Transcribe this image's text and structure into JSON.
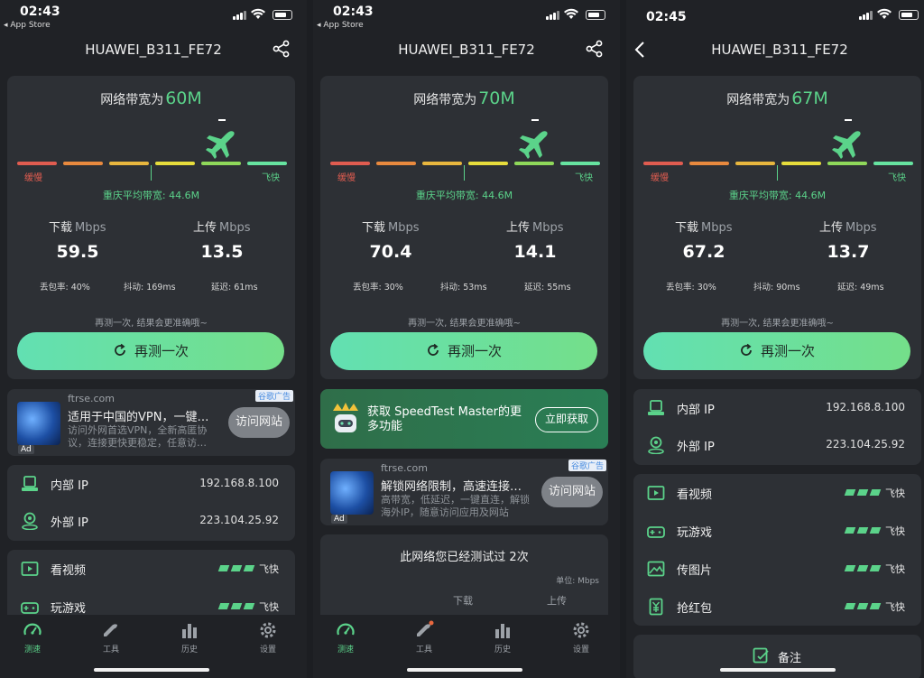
{
  "screens": [
    {
      "status": {
        "time": "02:43",
        "back": "◂ App Store"
      },
      "title": "HUAWEI_B311_FE72",
      "bandwidth": {
        "label": "网络带宽为",
        "value": "60M"
      },
      "scale": {
        "slow": "缓慢",
        "fast": "飞快",
        "avg": "重庆平均带宽: 44.6M"
      },
      "download": {
        "label": "下载",
        "unit": "Mbps",
        "value": "59.5"
      },
      "upload": {
        "label": "上传",
        "unit": "Mbps",
        "value": "13.5"
      },
      "loss": "丢包率: 40%",
      "jitter": "抖动: 169ms",
      "latency": "延迟: 61ms",
      "hint": "再测一次, 结果会更准确哦~",
      "retest": "再测一次",
      "ad": {
        "domain": "ftrse.com",
        "title": "适用于中国的VPN，一键…",
        "desc": "访问外网首选VPN，全新高匿协议，连接更快更稳定，任意访…",
        "button": "访问网站",
        "tag": "谷歌广告",
        "badge": "Ad"
      },
      "ip": {
        "inner_label": "内部 IP",
        "inner": "192.168.8.100",
        "outer_label": "外部 IP",
        "outer": "223.104.25.92"
      },
      "usage": [
        {
          "label": "看视频",
          "rating": "飞快"
        },
        {
          "label": "玩游戏",
          "rating": "飞快"
        }
      ]
    },
    {
      "status": {
        "time": "02:43",
        "back": "◂ App Store"
      },
      "title": "HUAWEI_B311_FE72",
      "bandwidth": {
        "label": "网络带宽为",
        "value": "70M"
      },
      "scale": {
        "slow": "缓慢",
        "fast": "飞快",
        "avg": "重庆平均带宽: 44.6M"
      },
      "download": {
        "label": "下载",
        "unit": "Mbps",
        "value": "70.4"
      },
      "upload": {
        "label": "上传",
        "unit": "Mbps",
        "value": "14.1"
      },
      "loss": "丢包率: 30%",
      "jitter": "抖动: 53ms",
      "latency": "延迟: 55ms",
      "hint": "再测一次, 结果会更准确哦~",
      "retest": "再测一次",
      "promo": {
        "text": "获取 SpeedTest Master的更多功能",
        "button": "立即获取"
      },
      "ad": {
        "domain": "ftrse.com",
        "title": "解锁网络限制，高速连接…",
        "desc": "高带宽，低延迟，一键直连，解锁海外IP，随意访问应用及网站",
        "button": "访问网站",
        "tag": "谷歌广告",
        "badge": "Ad"
      },
      "history": {
        "title": "此网络您已经测试过 2次",
        "unit": "单位: Mbps",
        "col1": "下载",
        "col2": "上传"
      }
    },
    {
      "status": {
        "time": "02:45"
      },
      "title": "HUAWEI_B311_FE72",
      "bandwidth": {
        "label": "网络带宽为",
        "value": "67M"
      },
      "scale": {
        "slow": "缓慢",
        "fast": "飞快",
        "avg": "重庆平均带宽: 44.6M"
      },
      "download": {
        "label": "下载",
        "unit": "Mbps",
        "value": "67.2"
      },
      "upload": {
        "label": "上传",
        "unit": "Mbps",
        "value": "13.7"
      },
      "loss": "丢包率: 30%",
      "jitter": "抖动: 90ms",
      "latency": "延迟: 49ms",
      "hint": "再测一次, 结果会更准确哦~",
      "retest": "再测一次",
      "ip": {
        "inner_label": "内部 IP",
        "inner": "192.168.8.100",
        "outer_label": "外部 IP",
        "outer": "223.104.25.92"
      },
      "usage": [
        {
          "label": "看视频",
          "rating": "飞快"
        },
        {
          "label": "玩游戏",
          "rating": "飞快"
        },
        {
          "label": "传图片",
          "rating": "飞快"
        },
        {
          "label": "抢红包",
          "rating": "飞快"
        }
      ],
      "note": "备注"
    }
  ],
  "tabs": [
    {
      "label": "测速",
      "icon": "speedometer-icon"
    },
    {
      "label": "工具",
      "icon": "wrench-icon"
    },
    {
      "label": "历史",
      "icon": "bar-chart-icon"
    },
    {
      "label": "设置",
      "icon": "gear-icon"
    }
  ],
  "colors": {
    "accent": "#5bd38a",
    "background": "#202226",
    "card": "#2d3035",
    "slow": "#e05c50"
  }
}
